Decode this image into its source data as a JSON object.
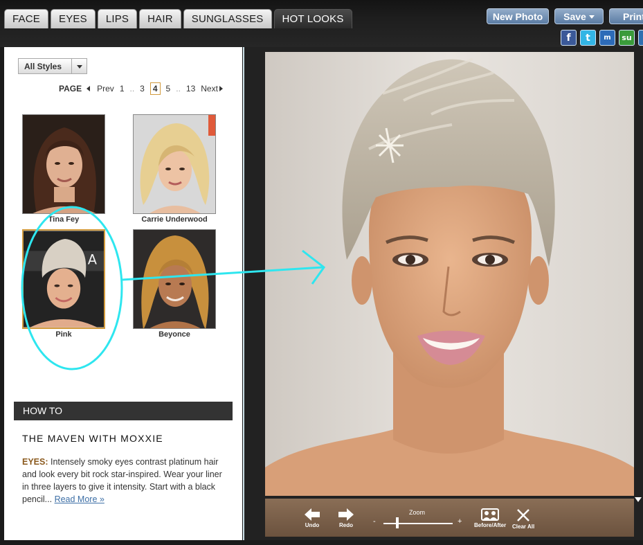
{
  "tabs": [
    {
      "label": "FACE"
    },
    {
      "label": "EYES"
    },
    {
      "label": "LIPS"
    },
    {
      "label": "HAIR"
    },
    {
      "label": "SUNGLASSES"
    },
    {
      "label": "HOT LOOKS",
      "active": true
    }
  ],
  "header_buttons": {
    "new_photo": "New Photo",
    "save": "Save",
    "print": "Print"
  },
  "social": [
    {
      "icon": "facebook-icon",
      "glyph": "f",
      "color": "#3b5998"
    },
    {
      "icon": "twitter-icon",
      "glyph": "t",
      "color": "#33ccff"
    },
    {
      "icon": "myspace-icon",
      "glyph": "m",
      "color": "#2d6bb8"
    },
    {
      "icon": "stumbleupon-icon",
      "glyph": "su",
      "color": "#3a9b3a"
    },
    {
      "icon": "share-icon",
      "glyph": "",
      "color": "#2f6fb0"
    }
  ],
  "filter": {
    "selected": "All Styles"
  },
  "pagination": {
    "label": "PAGE",
    "prev": "Prev",
    "pages": [
      "1",
      "..",
      "3",
      "4",
      "5",
      "..",
      "13"
    ],
    "current": "4",
    "next": "Next"
  },
  "looks": [
    {
      "name": "Tina Fey"
    },
    {
      "name": "Carrie Underwood"
    },
    {
      "name": "Pink",
      "selected": true
    },
    {
      "name": "Beyonce"
    }
  ],
  "how_to": {
    "header": "HOW TO",
    "title": "THE MAVEN WITH MOXXIE",
    "eyes_label": "EYES:",
    "description": " Intensely smoky eyes contrast platinum hair and look every bit rock star-inspired. Wear your liner in three layers to give it intensity. Start with a black pencil... ",
    "read_more": "Read More »"
  },
  "toolbar": {
    "undo": "Undo",
    "redo": "Redo",
    "zoom_label": "Zoom",
    "zoom_minus": "-",
    "zoom_plus": "+",
    "zoom_level": 0.2,
    "before_after": "Before/After",
    "clear_all": "Clear All"
  },
  "colors": {
    "accent_button": "#6f8fb5",
    "selected_border": "#d29a3c",
    "annotation": "#2ee6ef",
    "toolbar": "#7a604b"
  }
}
